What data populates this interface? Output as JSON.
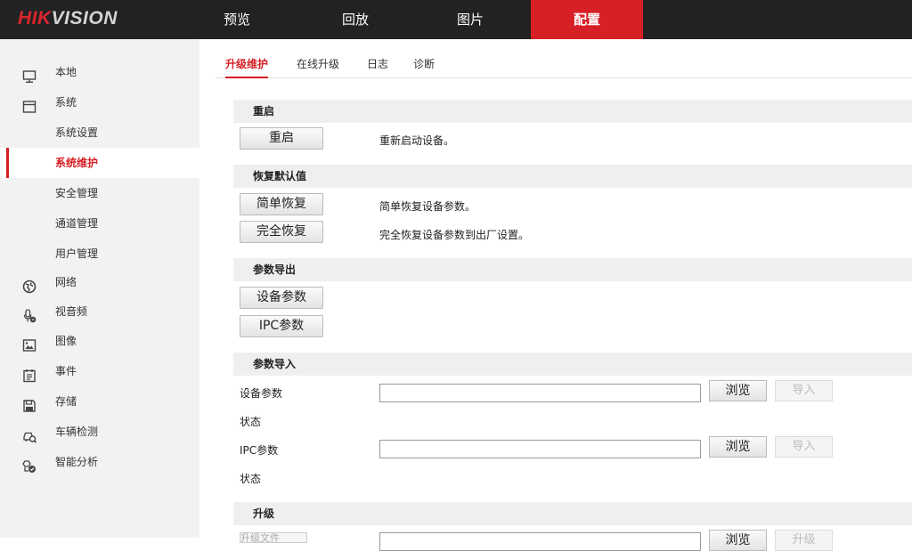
{
  "header": {
    "logo_brand": "HIK",
    "logo_rest": "VISION",
    "nav": [
      {
        "label": "预览"
      },
      {
        "label": "回放"
      },
      {
        "label": "图片"
      },
      {
        "label": "配置",
        "active": true
      }
    ]
  },
  "sidebar": {
    "items": [
      {
        "label": "本地",
        "icon": "monitor-icon"
      },
      {
        "label": "系统",
        "icon": "window-icon"
      },
      {
        "label": "系统设置"
      },
      {
        "label": "系统维护",
        "active": true
      },
      {
        "label": "安全管理"
      },
      {
        "label": "通道管理"
      },
      {
        "label": "用户管理"
      },
      {
        "label": "网络",
        "icon": "globe-icon"
      },
      {
        "label": "视音频",
        "icon": "mic-icon"
      },
      {
        "label": "图像",
        "icon": "image-icon"
      },
      {
        "label": "事件",
        "icon": "calendar-icon"
      },
      {
        "label": "存储",
        "icon": "save-icon"
      },
      {
        "label": "车辆检测",
        "icon": "car-search-icon"
      },
      {
        "label": "智能分析",
        "icon": "smart-analysis-icon"
      }
    ]
  },
  "tabs": [
    {
      "label": "升级维护",
      "active": true
    },
    {
      "label": "在线升级"
    },
    {
      "label": "日志"
    },
    {
      "label": "诊断"
    }
  ],
  "sections": {
    "reboot": {
      "title": "重启",
      "button": "重启",
      "desc": "重新启动设备。"
    },
    "restore": {
      "title": "恢复默认值",
      "simple_button": "简单恢复",
      "simple_desc": "简单恢复设备参数。",
      "full_button": "完全恢复",
      "full_desc": "完全恢复设备参数到出厂设置。"
    },
    "export": {
      "title": "参数导出",
      "device_button": "设备参数",
      "ipc_button": "IPC参数"
    },
    "import": {
      "title": "参数导入",
      "device_label": "设备参数",
      "device_status_label": "状态",
      "ipc_label": "IPC参数",
      "ipc_status_label": "状态",
      "browse_label": "浏览",
      "import_label": "导入"
    },
    "upgrade": {
      "title": "升级",
      "file_label": "升级文件",
      "browse_label": "浏览",
      "upgrade_label": "升级"
    }
  },
  "colors": {
    "accent": "#d71f26",
    "topbar": "#222222",
    "sidebar": "#f2f2f2",
    "section_header": "#efefef"
  }
}
